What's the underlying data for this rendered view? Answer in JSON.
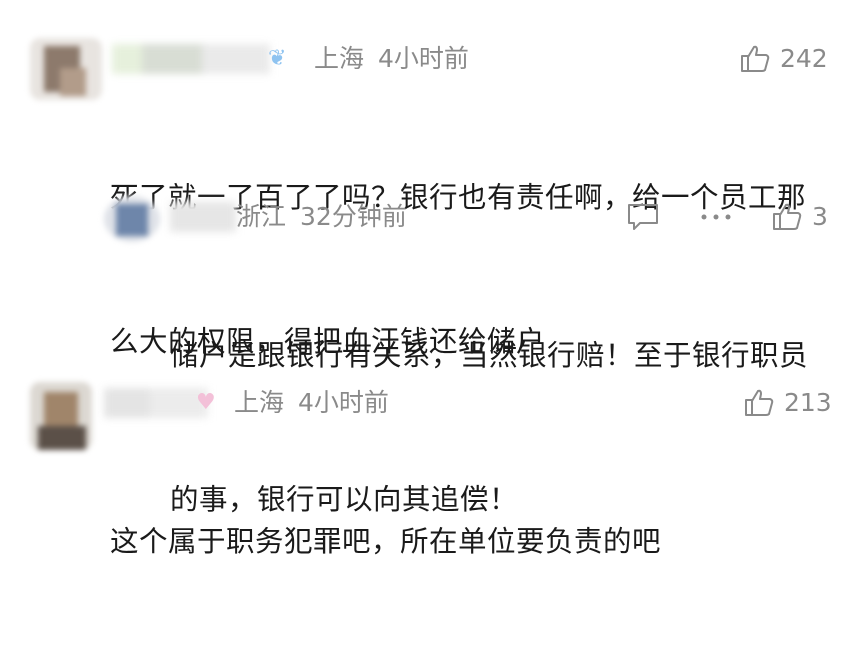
{
  "comments": [
    {
      "location": "上海",
      "time": "4小时前",
      "likes": "242",
      "lines": [
        "死了就一了百了了吗？银行也有责任啊，给一个员工那",
        "么大的权限，得把血汗钱还给储户"
      ]
    },
    {
      "location": "浙江",
      "time": "32分钟前",
      "likes": "3",
      "lines": [
        "储户是跟银行有关系，当然银行赔！至于银行职员",
        "的事，银行可以向其追偿！"
      ]
    },
    {
      "location": "上海",
      "time": "4小时前",
      "likes": "213",
      "lines": [
        "这个属于职务犯罪吧，所在单位要负责的吧"
      ]
    }
  ],
  "icons": {
    "like": "thumbs-up-icon",
    "reply": "comment-bubble-icon",
    "more": "more-dots-icon"
  },
  "colors": {
    "meta": "#8a8a8a",
    "text": "#1a1a1a"
  }
}
